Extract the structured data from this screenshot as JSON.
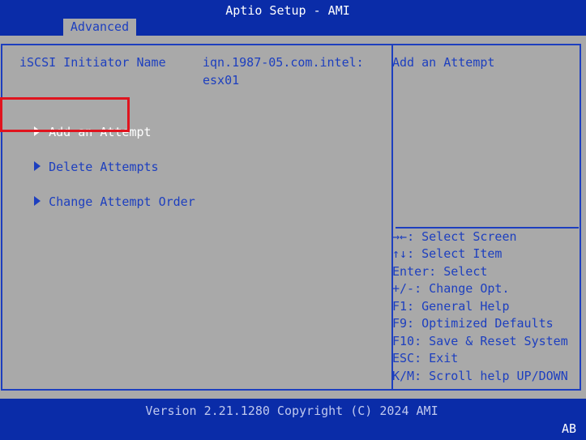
{
  "header": {
    "title": "Aptio Setup - AMI",
    "active_tab": "Advanced"
  },
  "setting": {
    "label": "iSCSI Initiator Name",
    "value_line1": "iqn.1987-05.com.intel:",
    "value_line2": "esx01"
  },
  "menu": {
    "items": [
      {
        "label": "Add an Attempt",
        "selected": true
      },
      {
        "label": "Delete Attempts",
        "selected": false
      },
      {
        "label": "Change Attempt Order",
        "selected": false
      }
    ]
  },
  "help": {
    "description": "Add an Attempt",
    "keys": [
      {
        "key": "→←",
        "desc": ": Select Screen"
      },
      {
        "key": "↑↓",
        "desc": ": Select Item"
      },
      {
        "key": "",
        "desc": "Enter: Select"
      },
      {
        "key": "",
        "desc": "+/-: Change Opt."
      },
      {
        "key": "",
        "desc": "F1: General Help"
      },
      {
        "key": "",
        "desc": "F9: Optimized Defaults"
      },
      {
        "key": "",
        "desc": "F10: Save & Reset System"
      },
      {
        "key": "",
        "desc": "ESC: Exit"
      },
      {
        "key": "",
        "desc": "K/M: Scroll help UP/DOWN"
      }
    ]
  },
  "footer": {
    "version": "Version 2.21.1280 Copyright (C) 2024 AMI",
    "corner": "AB"
  },
  "colors": {
    "bios_blue": "#0a2ca8",
    "panel_gray": "#a9a9a9",
    "text_blue": "#1d3fbf",
    "highlight_red": "#e0141e"
  }
}
